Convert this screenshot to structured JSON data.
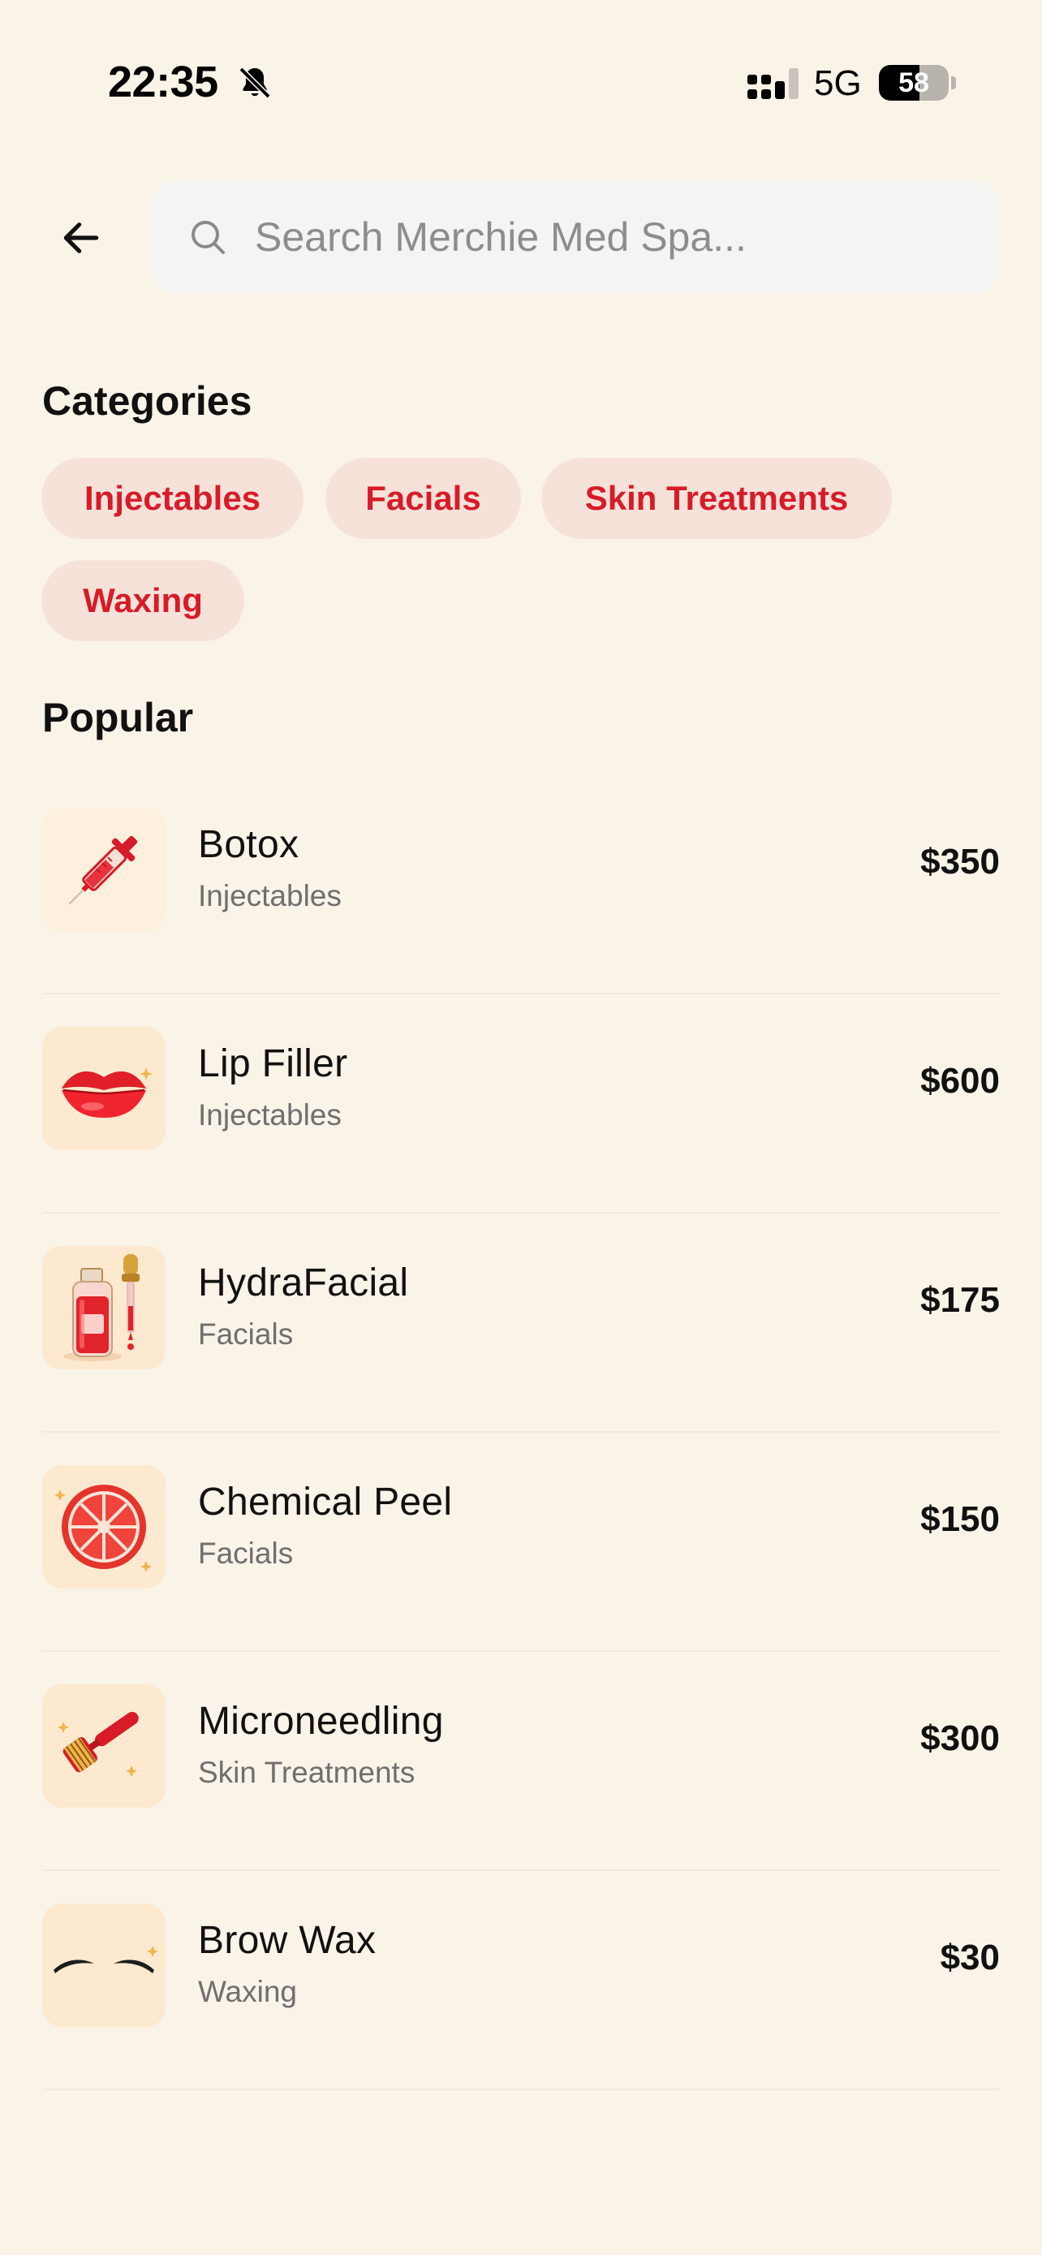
{
  "status_bar": {
    "time": "22:35",
    "network": "5G",
    "battery": "58",
    "battery_level": 0.58,
    "icons": [
      "bell-slash-icon",
      "signal-icon",
      "battery-icon"
    ]
  },
  "header": {
    "back_icon": "arrow-left-icon",
    "search": {
      "placeholder": "Search Merchie Med Spa...",
      "value": "",
      "icon": "search-icon"
    }
  },
  "categories": {
    "title": "Categories",
    "items": [
      "Injectables",
      "Facials",
      "Skin Treatments",
      "Waxing"
    ]
  },
  "popular": {
    "title": "Popular",
    "items": [
      {
        "name": "Botox",
        "category": "Injectables",
        "price": "$350",
        "icon": "syringe-icon"
      },
      {
        "name": "Lip Filler",
        "category": "Injectables",
        "price": "$600",
        "icon": "lips-icon"
      },
      {
        "name": "HydraFacial",
        "category": "Facials",
        "price": "$175",
        "icon": "serum-bottle-icon"
      },
      {
        "name": "Chemical Peel",
        "category": "Facials",
        "price": "$150",
        "icon": "grapefruit-icon"
      },
      {
        "name": "Microneedling",
        "category": "Skin Treatments",
        "price": "$300",
        "icon": "derma-roller-icon"
      },
      {
        "name": "Brow Wax",
        "category": "Waxing",
        "price": "$30",
        "icon": "eyebrows-icon"
      }
    ]
  },
  "colors": {
    "background": "#faf3e8",
    "accent": "#d81b28",
    "chip_background": "#f7e2da",
    "thumb_background": "#fde9cf"
  }
}
